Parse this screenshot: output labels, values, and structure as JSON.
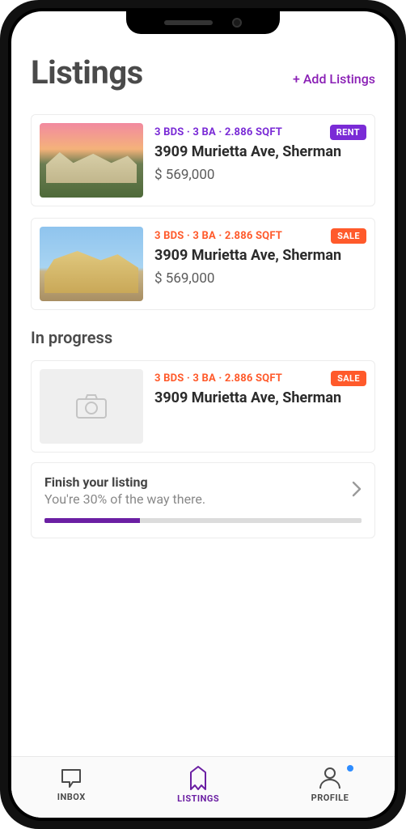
{
  "colors": {
    "purple": "#7a2bd6",
    "orange": "#ff5a2b",
    "brand": "#6b1fa3"
  },
  "header": {
    "title": "Listings",
    "add_label": "+ Add Listings"
  },
  "listings": [
    {
      "meta": "3 BDS · 3 BA · 2.886 SQFT",
      "badge": "RENT",
      "address": "3909 Murietta Ave, Sherman",
      "price": "$ 569,000",
      "variant": "purple"
    },
    {
      "meta": "3 BDS · 3 BA · 2.886 SQFT",
      "badge": "SALE",
      "address": "3909 Murietta Ave, Sherman",
      "price": "$ 569,000",
      "variant": "orange"
    }
  ],
  "section_in_progress": "In progress",
  "in_progress": {
    "meta": "3 BDS · 3 BA · 2.886 SQFT",
    "badge": "SALE",
    "address": "3909 Murietta Ave, Sherman",
    "variant": "orange"
  },
  "progress": {
    "title": "Finish your listing",
    "subtitle": "You're 30% of the way there.",
    "percent": 30
  },
  "nav": {
    "inbox": "INBOX",
    "listings": "LISTINGS",
    "profile": "PROFILE"
  }
}
